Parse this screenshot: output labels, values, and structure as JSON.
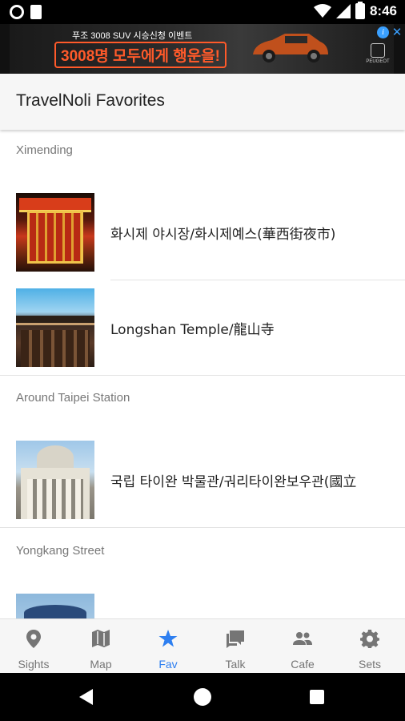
{
  "status_bar": {
    "time": "8:46"
  },
  "ad": {
    "line1": "푸조 3008 SUV 시승신청 이벤트",
    "line2": "3008명 모두에게 행운을!",
    "brand": "PEUGEOT",
    "info_icon": "info-icon",
    "close_icon": "close-icon"
  },
  "app_bar": {
    "title": "TravelNoli Favorites"
  },
  "sections": [
    {
      "header": "Ximending",
      "items": [
        {
          "title": "화시제 야시장/화시제예스(華西街夜市)"
        },
        {
          "title": "Longshan Temple/龍山寺"
        }
      ]
    },
    {
      "header": "Around Taipei Station",
      "items": [
        {
          "title": "국립 타이완 박물관/궈리타이완보우관(國立"
        }
      ]
    },
    {
      "header": "Yongkang Street",
      "items": [
        {
          "title": ""
        }
      ]
    }
  ],
  "bottom_nav": {
    "active": "Fav",
    "active_color": "#2e7ff0",
    "inactive_color": "#757575",
    "items": [
      {
        "label": "Sights",
        "icon": "location-pin-icon"
      },
      {
        "label": "Map",
        "icon": "map-icon"
      },
      {
        "label": "Fav",
        "icon": "star-icon"
      },
      {
        "label": "Talk",
        "icon": "chat-icon"
      },
      {
        "label": "Cafe",
        "icon": "people-icon"
      },
      {
        "label": "Sets",
        "icon": "gear-icon"
      }
    ]
  }
}
